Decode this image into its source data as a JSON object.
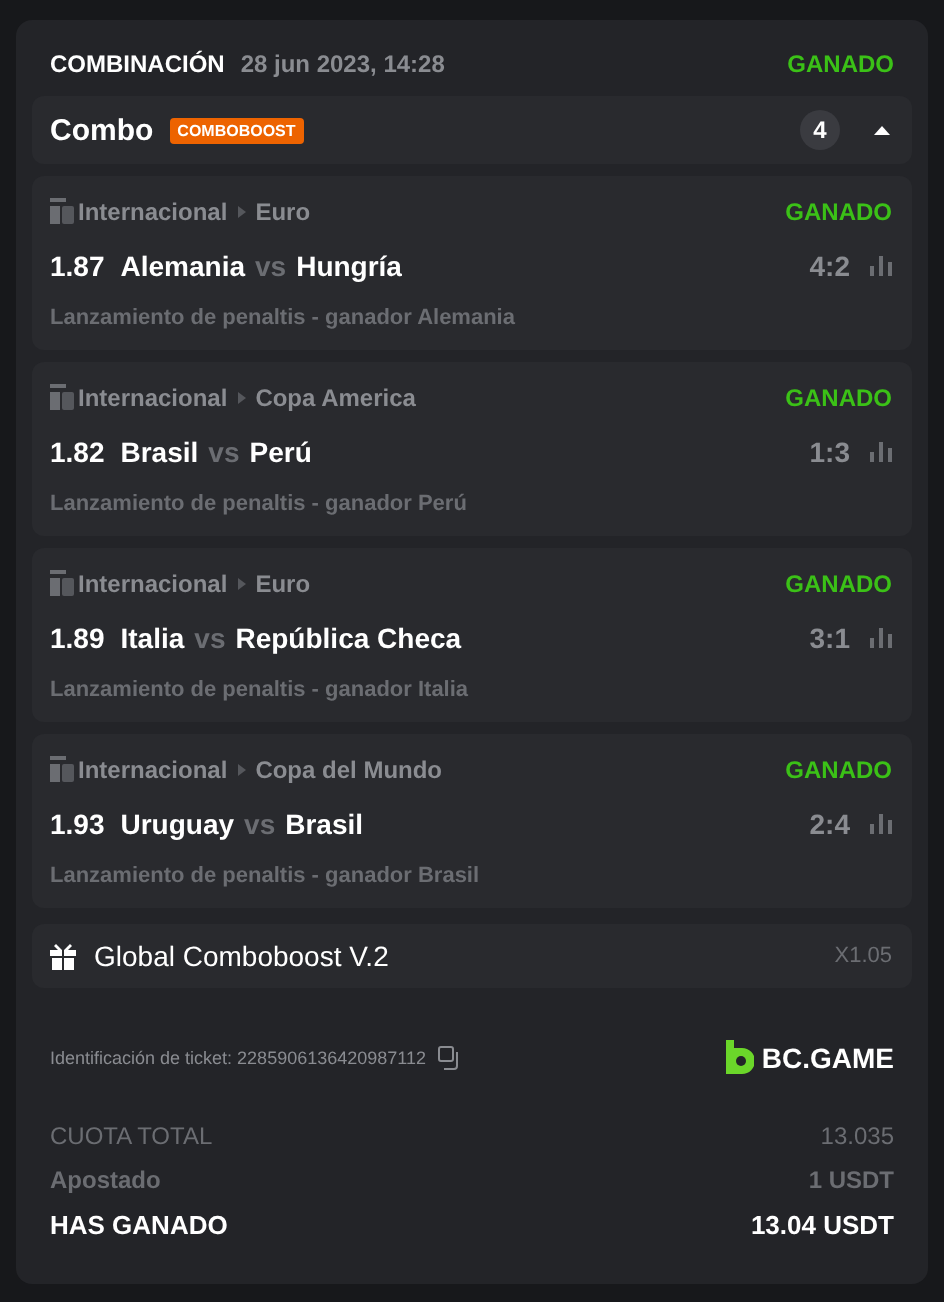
{
  "header": {
    "title": "COMBINACIÓN",
    "date": "28 jun 2023, 14:28",
    "status": "GANADO",
    "won": true
  },
  "combo": {
    "label": "Combo",
    "badge": "COMBOBOOST",
    "count": "4",
    "expanded": true
  },
  "selections": [
    {
      "category": "Internacional",
      "league": "Euro",
      "status": "GANADO",
      "won": true,
      "odds": "1.87",
      "home": "Alemania",
      "vs": "vs",
      "away": "Hungría",
      "score": "4:2",
      "market": "Lanzamiento de penaltis - ganador Alemania"
    },
    {
      "category": "Internacional",
      "league": "Copa America",
      "status": "GANADO",
      "won": true,
      "odds": "1.82",
      "home": "Brasil",
      "vs": "vs",
      "away": "Perú",
      "score": "1:3",
      "market": "Lanzamiento de penaltis - ganador Perú"
    },
    {
      "category": "Internacional",
      "league": "Euro",
      "status": "GANADO",
      "won": true,
      "odds": "1.89",
      "home": "Italia",
      "vs": "vs",
      "away": "República Checa",
      "score": "3:1",
      "market": "Lanzamiento de penaltis - ganador Italia"
    },
    {
      "category": "Internacional",
      "league": "Copa del Mundo",
      "status": "GANADO",
      "won": true,
      "odds": "1.93",
      "home": "Uruguay",
      "vs": "vs",
      "away": "Brasil",
      "score": "2:4",
      "market": "Lanzamiento de penaltis - ganador Brasil"
    }
  ],
  "boost": {
    "label": "Global Comboboost V.2",
    "multiplier": "X1.05"
  },
  "ticket": {
    "id": "Identificación de ticket: 2285906136420987112",
    "brand": "BC.GAME"
  },
  "totals": [
    {
      "kind": "plain",
      "label": "CUOTA TOTAL",
      "value": "13.035"
    },
    {
      "kind": "muted",
      "label": "Apostado",
      "value": "1 USDT"
    },
    {
      "kind": "strong",
      "label": "HAS GANADO",
      "value": "13.04 USDT"
    }
  ]
}
